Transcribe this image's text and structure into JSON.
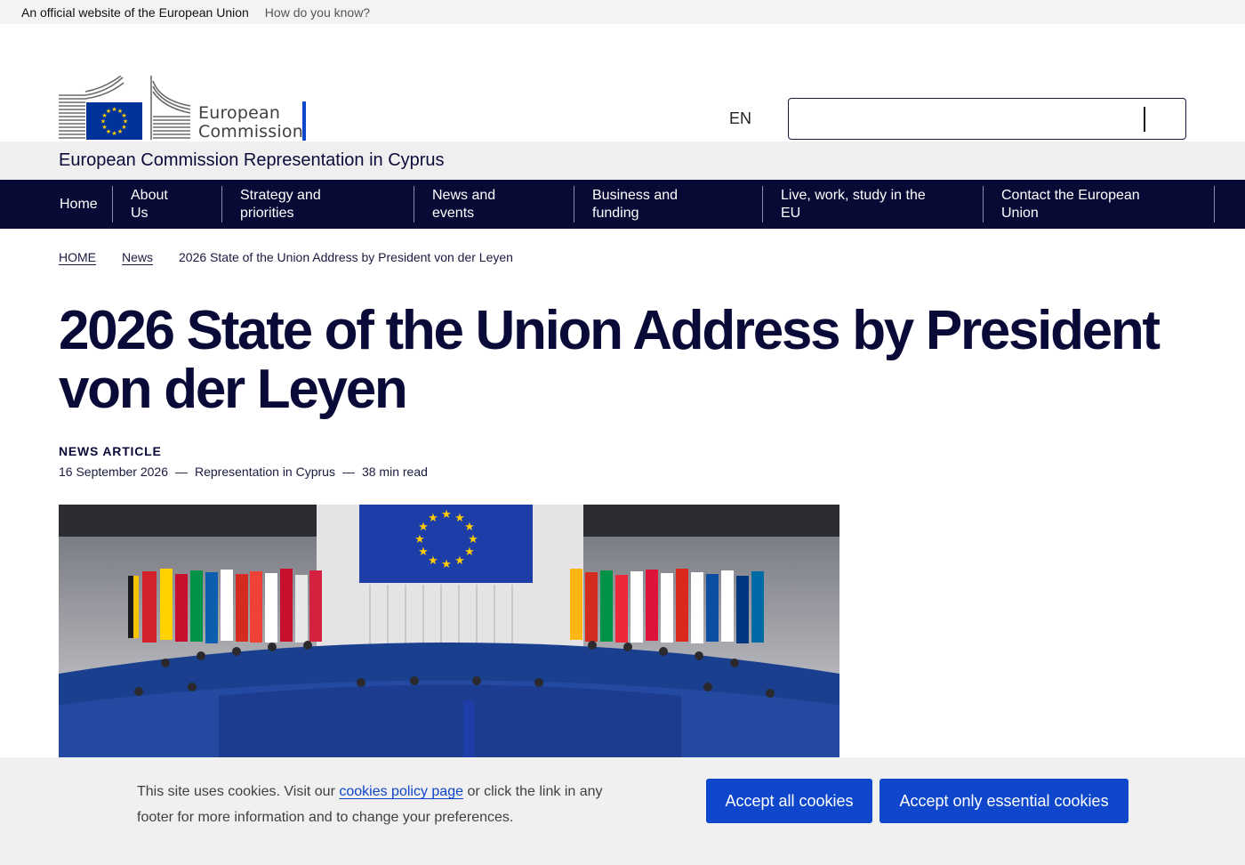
{
  "topbar": {
    "official": "An official website of the European Union",
    "how": "How do you know?"
  },
  "header": {
    "logo_line1": "European",
    "logo_line2": "Commission",
    "language": "EN",
    "search_value": ""
  },
  "site_name": "European Commission Representation in Cyprus",
  "nav": {
    "items": [
      {
        "line1": "Home",
        "line2": ""
      },
      {
        "line1": "About",
        "line2": "Us"
      },
      {
        "line1": "Strategy and",
        "line2": "priorities"
      },
      {
        "line1": "News and",
        "line2": "events"
      },
      {
        "line1": "Business and",
        "line2": "funding"
      },
      {
        "line1": "Live, work, study in the",
        "line2": "EU"
      },
      {
        "line1": "Contact the European",
        "line2": "Union"
      }
    ]
  },
  "breadcrumb": {
    "home": "HOME",
    "news": "News",
    "current": "2026 State of the Union Address by President von der Leyen"
  },
  "article": {
    "title": "2026 State of the Union Address by President von der Leyen",
    "type": "NEWS ARTICLE",
    "date": "16 September 2026",
    "separator": "—",
    "author": "Representation in Cyprus",
    "read_time": "38 min read"
  },
  "cookie": {
    "text_before": "This site uses cookies. Visit our ",
    "link": "cookies policy page",
    "text_after": " or click the link in any footer for more information and to change your preferences.",
    "accept_all": "Accept all cookies",
    "accept_essential": "Accept only essential cookies"
  },
  "colors": {
    "eu_blue": "#0e47cb",
    "nav_bg": "#080a36",
    "flag_blue": "#003399",
    "flag_gold": "#ffcc00"
  }
}
